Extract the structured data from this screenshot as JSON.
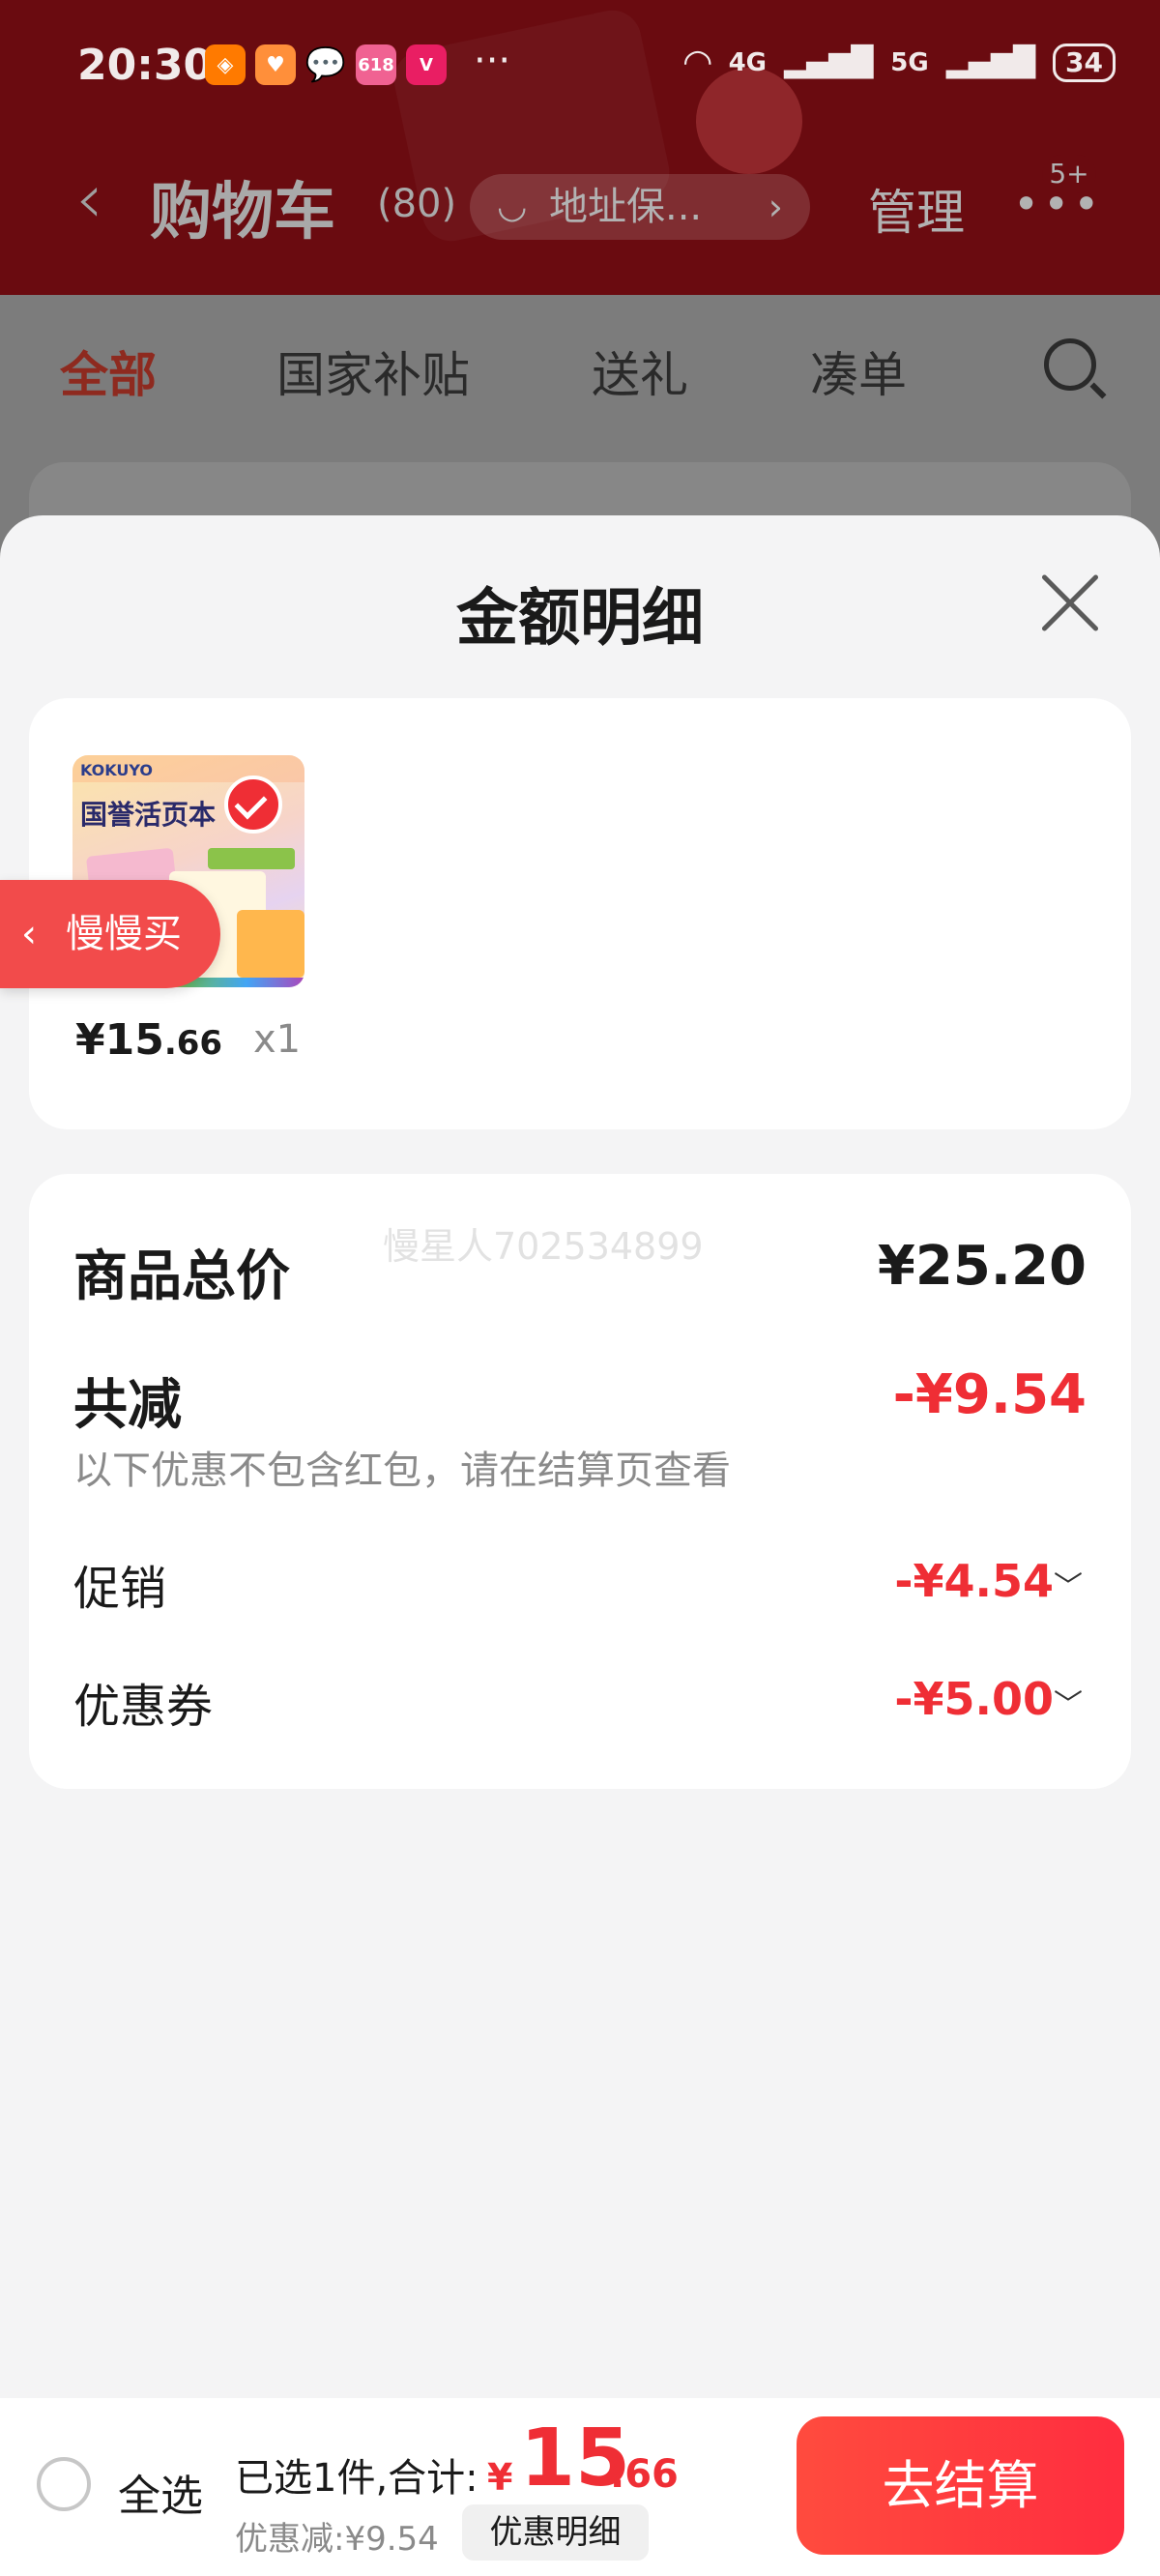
{
  "status_bar": {
    "time": "20:30",
    "more": "···",
    "signal_4g": "4G",
    "signal_5g": "5G",
    "battery": "34",
    "app_icons": [
      "taobao-app-icon",
      "health-app-icon",
      "wechat-icon",
      "618-app-icon",
      "vip-app-icon"
    ]
  },
  "nav": {
    "back_icon": "chevron-left-icon",
    "title": "购物车",
    "count": "(80)",
    "address": "地址保...",
    "manage": "管理",
    "badge": "5+"
  },
  "tabs": [
    {
      "label": "全部",
      "active": true
    },
    {
      "label": "国家补贴",
      "active": false
    },
    {
      "label": "送礼",
      "active": false
    },
    {
      "label": "凑单",
      "active": false
    }
  ],
  "sheet": {
    "title": "金额明细",
    "item": {
      "thumb_brand": "KOKUYO",
      "thumb_title": "国誉活页本",
      "price_int": "¥15",
      "price_dec": ".66",
      "qty": "x1"
    },
    "float_tab": "慢慢买",
    "watermark": "慢星人702534899",
    "breakdown": {
      "total_label": "商品总价",
      "total_value": "¥25.20",
      "reduce_label": "共减",
      "reduce_value": "-¥9.54",
      "reduce_note": "以下优惠不包含红包，请在结算页查看",
      "promo_label": "促销",
      "promo_value": "-¥4.54",
      "coupon_label": "优惠券",
      "coupon_value": "-¥5.00"
    }
  },
  "bottom_bar": {
    "select_all": "全选",
    "summary": "已选1件,合计:",
    "currency": "¥",
    "total_int": "15",
    "total_dec": ".66",
    "discount": "优惠减:¥9.54",
    "detail_button": "优惠明细",
    "checkout_button": "去结算"
  },
  "colors": {
    "accent": "#ef2e35",
    "header_bg": "#6a0b10",
    "sheet_bg": "#f4f4f5"
  }
}
